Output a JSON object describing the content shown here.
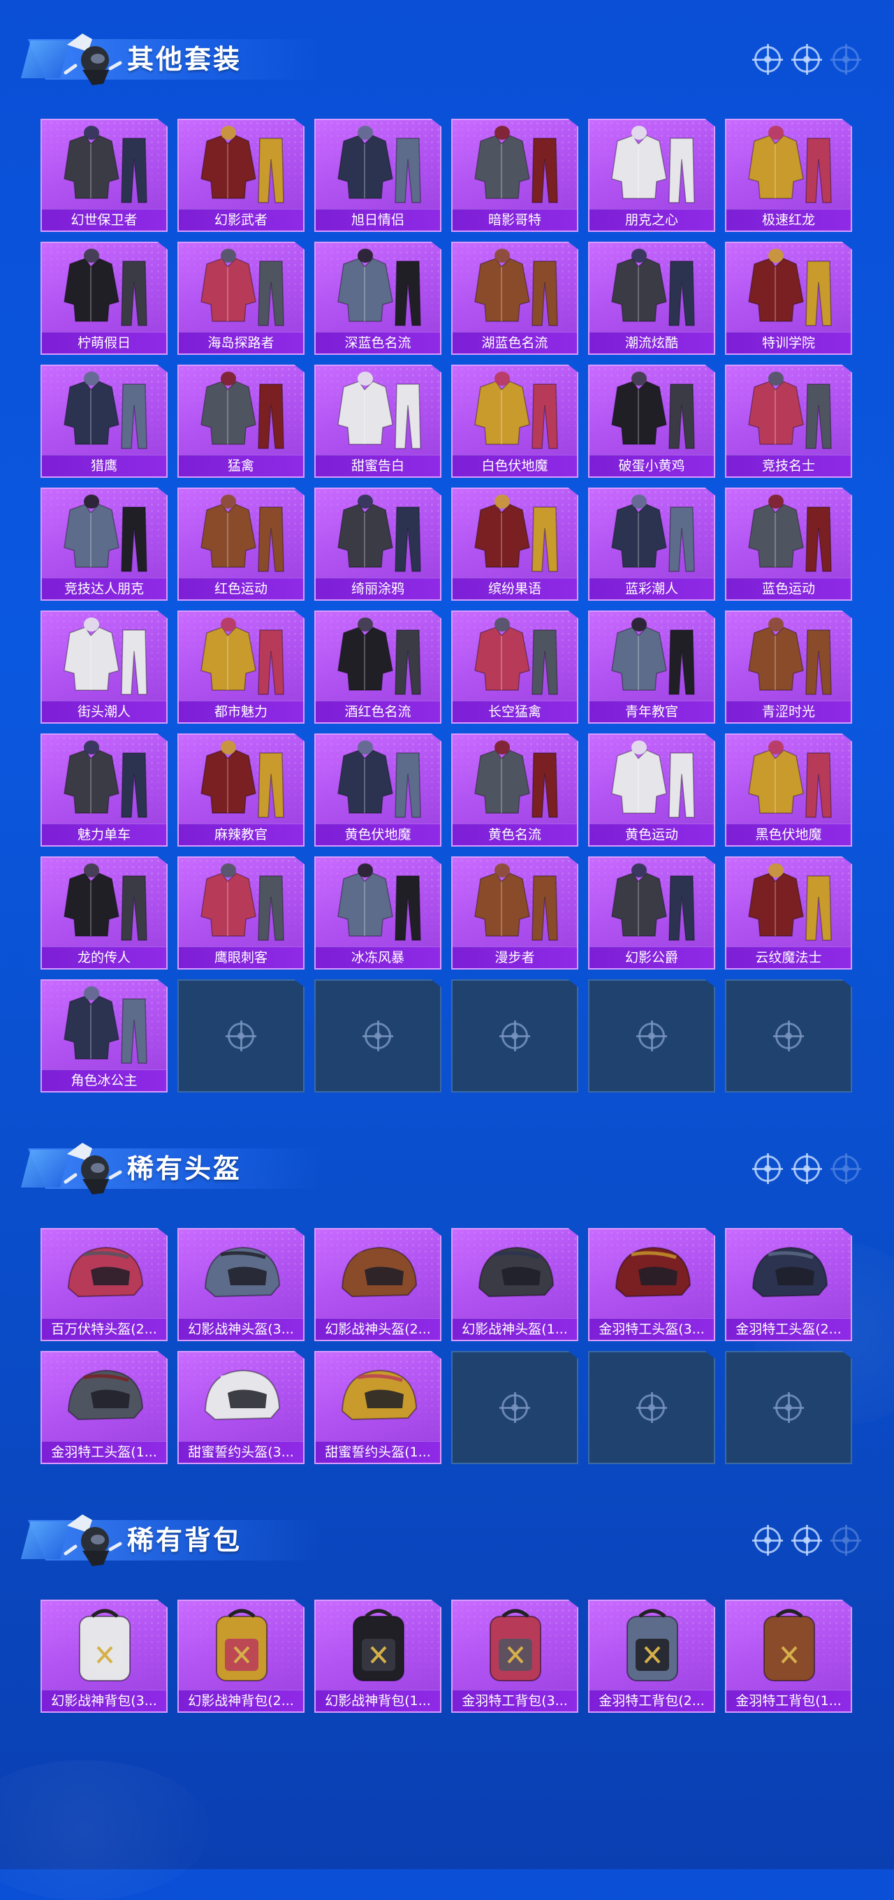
{
  "sections": [
    {
      "title": "其他套装",
      "items": [
        {
          "label": "幻世保卫者",
          "kind": "outfit"
        },
        {
          "label": "幻影武者",
          "kind": "outfit"
        },
        {
          "label": "旭日情侣",
          "kind": "outfit"
        },
        {
          "label": "暗影哥特",
          "kind": "outfit"
        },
        {
          "label": "朋克之心",
          "kind": "outfit"
        },
        {
          "label": "极速红龙",
          "kind": "outfit"
        },
        {
          "label": "柠萌假日",
          "kind": "outfit"
        },
        {
          "label": "海岛探路者",
          "kind": "outfit"
        },
        {
          "label": "深蓝色名流",
          "kind": "outfit"
        },
        {
          "label": "湖蓝色名流",
          "kind": "outfit"
        },
        {
          "label": "潮流炫酷",
          "kind": "outfit"
        },
        {
          "label": "特训学院",
          "kind": "outfit"
        },
        {
          "label": "猎鹰",
          "kind": "outfit"
        },
        {
          "label": "猛禽",
          "kind": "outfit"
        },
        {
          "label": "甜蜜告白",
          "kind": "outfit"
        },
        {
          "label": "白色伏地魔",
          "kind": "outfit"
        },
        {
          "label": "破蛋小黄鸡",
          "kind": "outfit"
        },
        {
          "label": "竞技名士",
          "kind": "outfit"
        },
        {
          "label": "竞技达人朋克",
          "kind": "outfit"
        },
        {
          "label": "红色运动",
          "kind": "outfit"
        },
        {
          "label": "绮丽涂鸦",
          "kind": "outfit"
        },
        {
          "label": "缤纷果语",
          "kind": "outfit"
        },
        {
          "label": "蓝彩潮人",
          "kind": "outfit"
        },
        {
          "label": "蓝色运动",
          "kind": "outfit"
        },
        {
          "label": "街头潮人",
          "kind": "outfit"
        },
        {
          "label": "都市魅力",
          "kind": "outfit"
        },
        {
          "label": "酒红色名流",
          "kind": "outfit"
        },
        {
          "label": "长空猛禽",
          "kind": "outfit"
        },
        {
          "label": "青年教官",
          "kind": "outfit"
        },
        {
          "label": "青涩时光",
          "kind": "outfit"
        },
        {
          "label": "魅力单车",
          "kind": "outfit"
        },
        {
          "label": "麻辣教官",
          "kind": "outfit"
        },
        {
          "label": "黄色伏地魔",
          "kind": "outfit"
        },
        {
          "label": "黄色名流",
          "kind": "outfit"
        },
        {
          "label": "黄色运动",
          "kind": "outfit"
        },
        {
          "label": "黑色伏地魔",
          "kind": "outfit"
        },
        {
          "label": "龙的传人",
          "kind": "outfit"
        },
        {
          "label": "鹰眼刺客",
          "kind": "outfit"
        },
        {
          "label": "冰冻风暴",
          "kind": "outfit"
        },
        {
          "label": "漫步者",
          "kind": "outfit"
        },
        {
          "label": "幻影公爵",
          "kind": "outfit"
        },
        {
          "label": "云纹魔法士",
          "kind": "outfit"
        },
        {
          "label": "角色冰公主",
          "kind": "outfit"
        }
      ],
      "empty_slots": 5
    },
    {
      "title": "稀有头盔",
      "items": [
        {
          "label": "百万伏特头盔(2...",
          "kind": "helmet"
        },
        {
          "label": "幻影战神头盔(3...",
          "kind": "helmet"
        },
        {
          "label": "幻影战神头盔(2...",
          "kind": "helmet"
        },
        {
          "label": "幻影战神头盔(1...",
          "kind": "helmet"
        },
        {
          "label": "金羽特工头盔(3...",
          "kind": "helmet"
        },
        {
          "label": "金羽特工头盔(2...",
          "kind": "helmet"
        },
        {
          "label": "金羽特工头盔(1...",
          "kind": "helmet"
        },
        {
          "label": "甜蜜誓约头盔(3...",
          "kind": "helmet"
        },
        {
          "label": "甜蜜誓约头盔(1...",
          "kind": "helmet"
        }
      ],
      "empty_slots": 3
    },
    {
      "title": "稀有背包",
      "items": [
        {
          "label": "幻影战神背包(3...",
          "kind": "backpack"
        },
        {
          "label": "幻影战神背包(2...",
          "kind": "backpack"
        },
        {
          "label": "幻影战神背包(1...",
          "kind": "backpack"
        },
        {
          "label": "金羽特工背包(3...",
          "kind": "backpack"
        },
        {
          "label": "金羽特工背包(2...",
          "kind": "backpack"
        },
        {
          "label": "金羽特工背包(1...",
          "kind": "backpack"
        }
      ],
      "empty_slots": 0
    }
  ],
  "icons": {
    "header_character": "parachute-character-icon",
    "header_target": "crosshair-icon",
    "empty_slot": "crosshair-icon"
  },
  "colors": {
    "background": "#0b58e0",
    "card": "#b254f2",
    "label_bar": "#8f2ae6",
    "empty_slot": "#20426f"
  }
}
